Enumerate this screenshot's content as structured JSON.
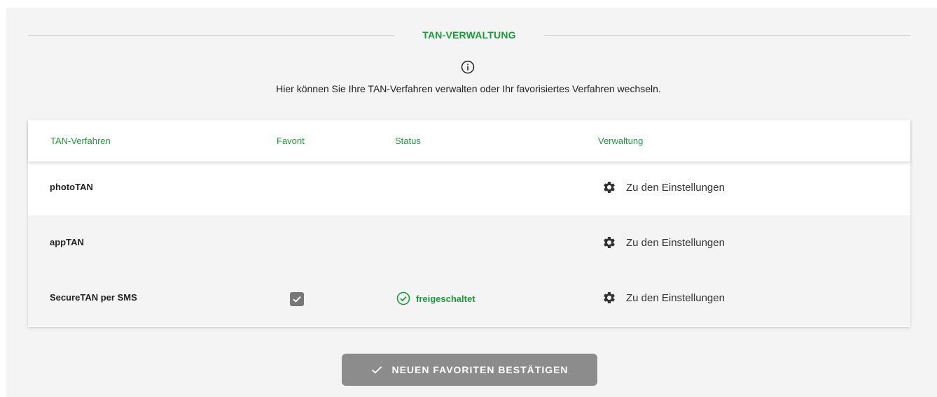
{
  "section": {
    "title": "TAN-VERWALTUNG",
    "info_text": "Hier können Sie Ihre TAN-Verfahren verwalten oder Ihr favorisiertes Verfahren wechseln."
  },
  "table": {
    "headers": {
      "method": "TAN-Verfahren",
      "favorite": "Favorit",
      "status": "Status",
      "management": "Verwaltung"
    },
    "rows": [
      {
        "name": "photoTAN",
        "favorite": false,
        "status": "",
        "action": "Zu den Einstellungen"
      },
      {
        "name": "appTAN",
        "favorite": false,
        "status": "",
        "action": "Zu den Einstellungen"
      },
      {
        "name": "SecureTAN per SMS",
        "favorite": true,
        "status": "freigeschaltet",
        "action": "Zu den Einstellungen"
      }
    ]
  },
  "confirm_button": {
    "label": "NEUEN FAVORITEN BESTÄTIGEN",
    "enabled": false
  },
  "icons": {
    "info": "info-icon",
    "gear": "gear-icon",
    "check_circle": "check-circle-icon",
    "checkbox": "checkbox-checked-icon",
    "check": "check-icon"
  },
  "colors": {
    "accent": "#1a9c3a",
    "panel_bg": "#f4f4f4",
    "button_disabled": "#8c8c8c"
  }
}
